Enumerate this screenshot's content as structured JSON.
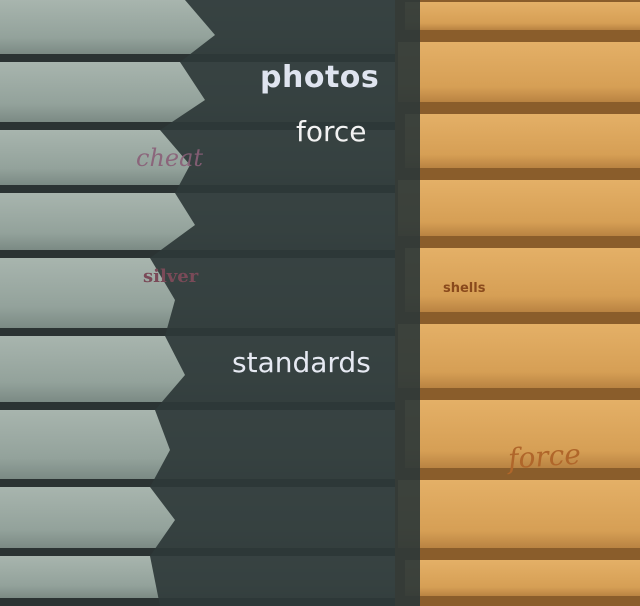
{
  "scene": {
    "subject": "",
    "colors": {
      "left_siding": "#8f9e98",
      "left_siding_light": "#a7b4ad",
      "siding_gap": "#2b3333",
      "shadow": "#2e3838",
      "right_siding": "#d9a35a",
      "right_siding_shadow": "#8a5d2b"
    }
  },
  "overlay_words": {
    "photos": "photos",
    "force_top": "force",
    "cheat": "cheat",
    "silver": "silver",
    "shells": "shells",
    "standards": "standards",
    "force_bottom": "force"
  }
}
